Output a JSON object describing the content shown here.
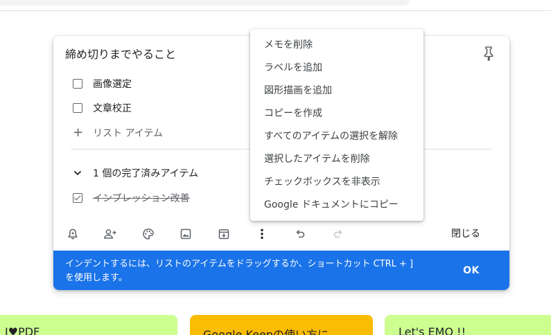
{
  "note": {
    "title": "締め切りまでやること",
    "items": [
      {
        "label": "画像選定",
        "checked": false
      },
      {
        "label": "文章校正",
        "checked": false
      }
    ],
    "add_item_placeholder": "リスト アイテム",
    "completed_header": "1 個の完了済みアイテム",
    "completed_items": [
      {
        "label": "インプレッション改善",
        "checked": true
      }
    ],
    "close_label": "閉じる"
  },
  "toolbar": {
    "icons": [
      "reminder-icon",
      "collaborator-icon",
      "palette-icon",
      "image-icon",
      "archive-icon",
      "more-icon",
      "undo-icon",
      "redo-icon"
    ]
  },
  "snackbar": {
    "line1": "インデントするには、リストのアイテムをドラッグするか、ショートカット CTRL + ]",
    "line2": "を使用します。",
    "ok_label": "OK"
  },
  "menu": {
    "items": [
      "メモを削除",
      "ラベルを追加",
      "図形描画を追加",
      "コピーを作成",
      "すべてのアイテムの選択を解除",
      "選択したアイテムを削除",
      "チェックボックスを非表示",
      "Google ドキュメントにコピー"
    ]
  },
  "cards": [
    {
      "title": "I♥PDF",
      "color": "#ccff90"
    },
    {
      "title": "Google Keepの使い方に",
      "color": "#fbbc04"
    },
    {
      "title": "Let's EMO !!",
      "color": "#ccff90"
    }
  ],
  "colors": {
    "accent": "#1a73e8",
    "icon": "#5f6368"
  }
}
